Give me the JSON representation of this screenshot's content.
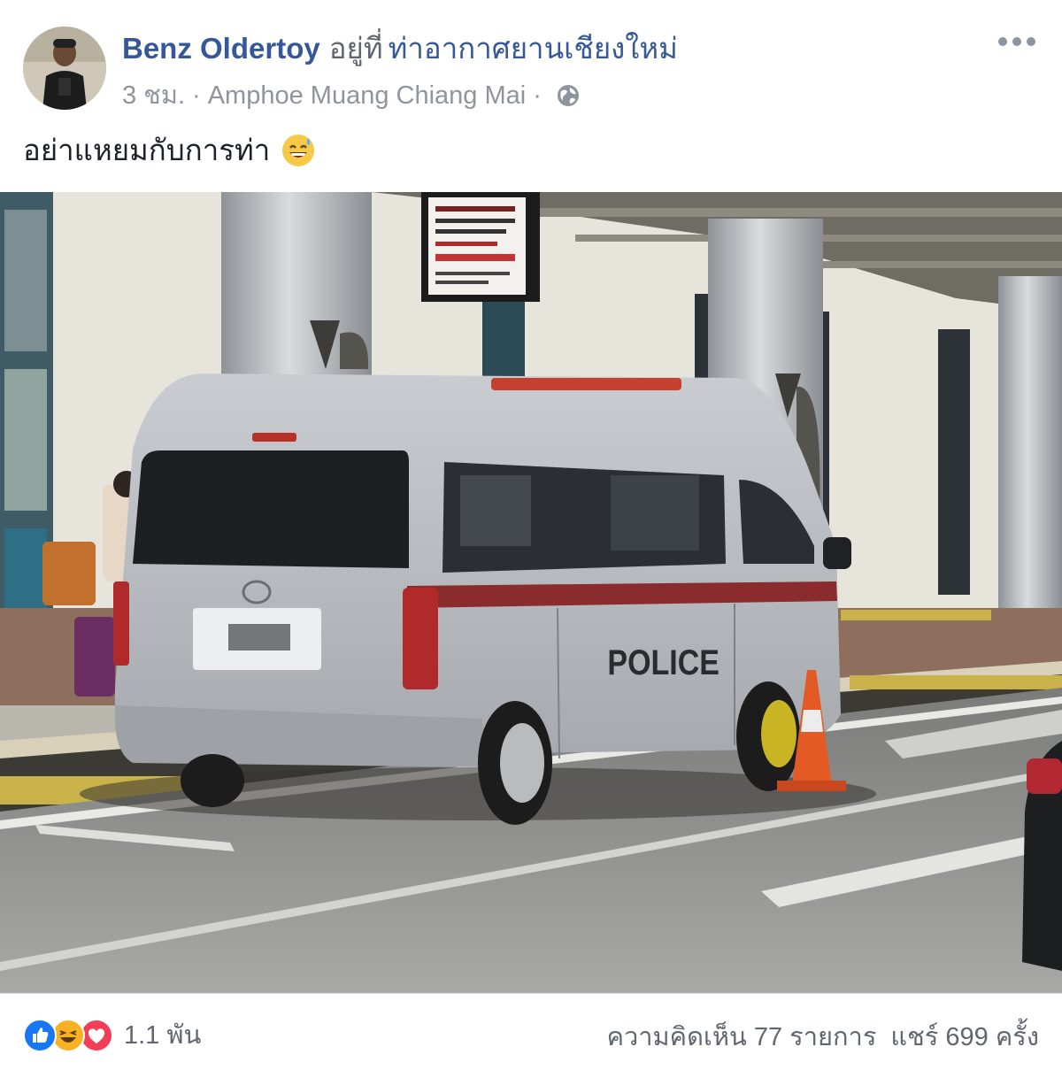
{
  "post": {
    "author_name": "Benz Oldertoy",
    "at_text": "อยู่ที่",
    "place_name": "ท่าอากาศยานเชียงใหม่",
    "time": "3 ชม.",
    "separator": "·",
    "location": "Amphoe Muang Chiang Mai",
    "privacy_icon": "globe-icon",
    "text": "อย่าแหยมกับการท่า",
    "text_emoji": "grinning-sweat-emoji"
  },
  "photo": {
    "van_label": "POLICE"
  },
  "footer": {
    "reaction_icons": [
      "like-icon",
      "haha-icon",
      "love-icon"
    ],
    "reaction_count": "1.1 พัน",
    "comments": "ความคิดเห็น 77 รายการ",
    "shares": "แชร์ 699 ครั้ง"
  },
  "colors": {
    "link": "#365899",
    "secondary_text": "#90949c",
    "like_blue": "#1877f2",
    "love_red": "#f33e58",
    "haha_yellow": "#f7b125"
  }
}
